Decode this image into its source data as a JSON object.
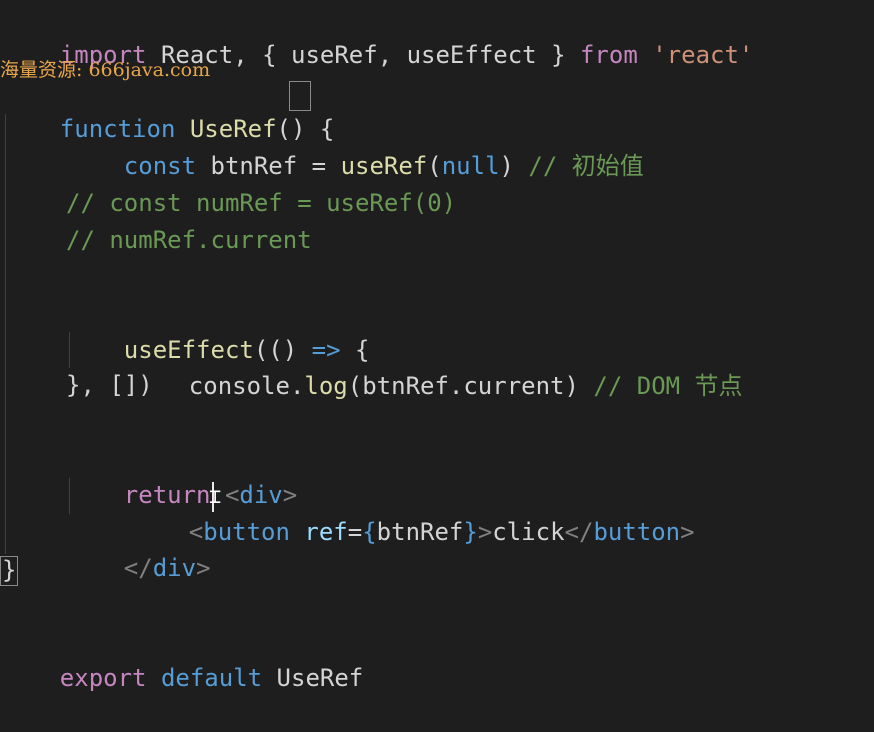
{
  "editor": {
    "watermark": "海量资源: 666java.com",
    "lines": {
      "import": {
        "kw_import": "import",
        "text1": " React, { useRef, useEffect } ",
        "kw_from": "from",
        "space": " ",
        "module": "'react'"
      },
      "function_decl": {
        "kw_function": "function",
        "space": " ",
        "name": "UseRef",
        "parens": "() ",
        "brace": "{"
      },
      "const_btnref": {
        "kw_const": "const",
        "var": " btnRef",
        "eq": " = ",
        "call": "useRef",
        "open": "(",
        "null": "null",
        "close": ") ",
        "comment": "// 初始值"
      },
      "comment_numref": "// const numRef = useRef(0)",
      "comment_current": "// numRef.current",
      "use_effect": {
        "call": "useEffect",
        "open": "(() ",
        "arrow": "=>",
        "brace": " {"
      },
      "console_log": {
        "obj": "console",
        "dot": ".",
        "method": "log",
        "args": "(btnRef.current) ",
        "comment": "// DOM 节点"
      },
      "close_effect": "}, [])",
      "return_line": {
        "kw_return": "return",
        "space": " ",
        "lt": "<",
        "tag": "div",
        "gt": ">"
      },
      "button_line": {
        "lt": "<",
        "tag": "button",
        "space": " ",
        "attr": "ref",
        "eq": "=",
        "expr_open": "{",
        "expr": "btnRef",
        "expr_close": "}",
        "gt": ">",
        "text": "click",
        "close_lt": "</",
        "close_tag": "button",
        "close_gt": ">"
      },
      "close_div": {
        "lt": "</",
        "tag": "div",
        "gt": ">"
      },
      "close_function": "}",
      "export_line": {
        "kw_export": "export",
        "kw_default": " default ",
        "name": "UseRef"
      }
    }
  }
}
